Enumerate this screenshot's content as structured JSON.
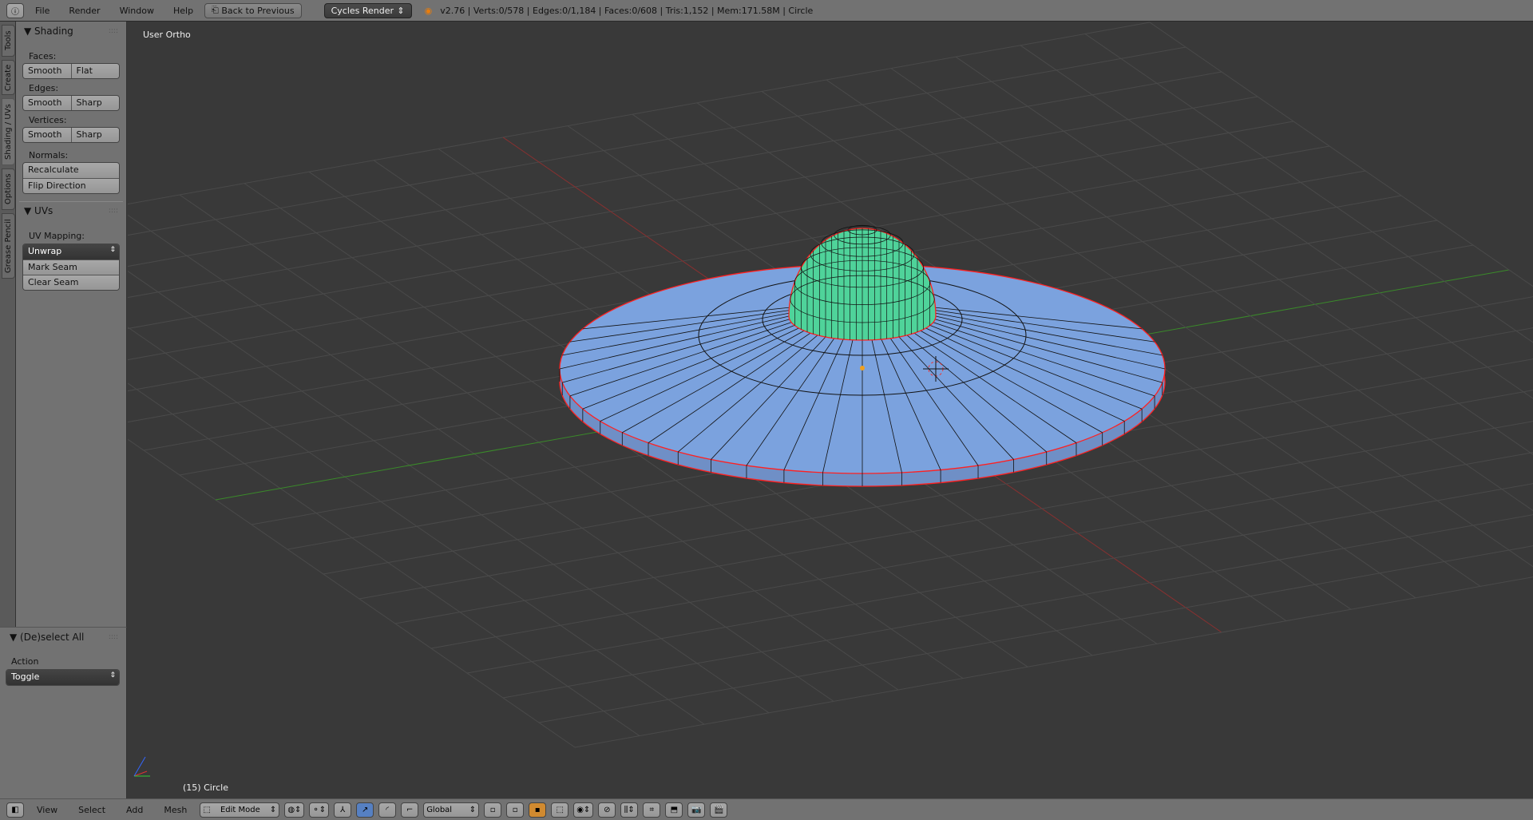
{
  "topbar": {
    "menus": [
      "File",
      "Render",
      "Window",
      "Help"
    ],
    "back_button": "Back to Previous",
    "render_engine": "Cycles Render",
    "stats": "v2.76 | Verts:0/578 | Edges:0/1,184 | Faces:0/608 | Tris:1,152 | Mem:171.58M | Circle"
  },
  "tabs": [
    "Tools",
    "Create",
    "Shading / UVs",
    "Options",
    "Grease Pencil"
  ],
  "shading": {
    "title": "Shading",
    "faces_label": "Faces:",
    "faces": [
      "Smooth",
      "Flat"
    ],
    "edges_label": "Edges:",
    "edges": [
      "Smooth",
      "Sharp"
    ],
    "vertices_label": "Vertices:",
    "vertices": [
      "Smooth",
      "Sharp"
    ],
    "normals_label": "Normals:",
    "normals": [
      "Recalculate",
      "Flip Direction"
    ]
  },
  "uvs": {
    "title": "UVs",
    "mapping_label": "UV Mapping:",
    "mapping_value": "Unwrap",
    "buttons": [
      "Mark Seam",
      "Clear Seam"
    ]
  },
  "operator": {
    "title": "(De)select All",
    "action_label": "Action",
    "action_value": "Toggle"
  },
  "viewport": {
    "view_name": "User Ortho",
    "object_info": "(15) Circle",
    "colors": {
      "background": "#393939",
      "grid": "#4a4a4a",
      "x_axis": "#8a3030",
      "y_axis": "#3a8a2a",
      "selected_faces": "#4fd39a",
      "disc": "#7aa0dc",
      "edge": "#ff2020"
    }
  },
  "bottombar": {
    "menus": [
      "View",
      "Select",
      "Add",
      "Mesh"
    ],
    "mode": "Edit Mode",
    "orientation": "Global"
  }
}
